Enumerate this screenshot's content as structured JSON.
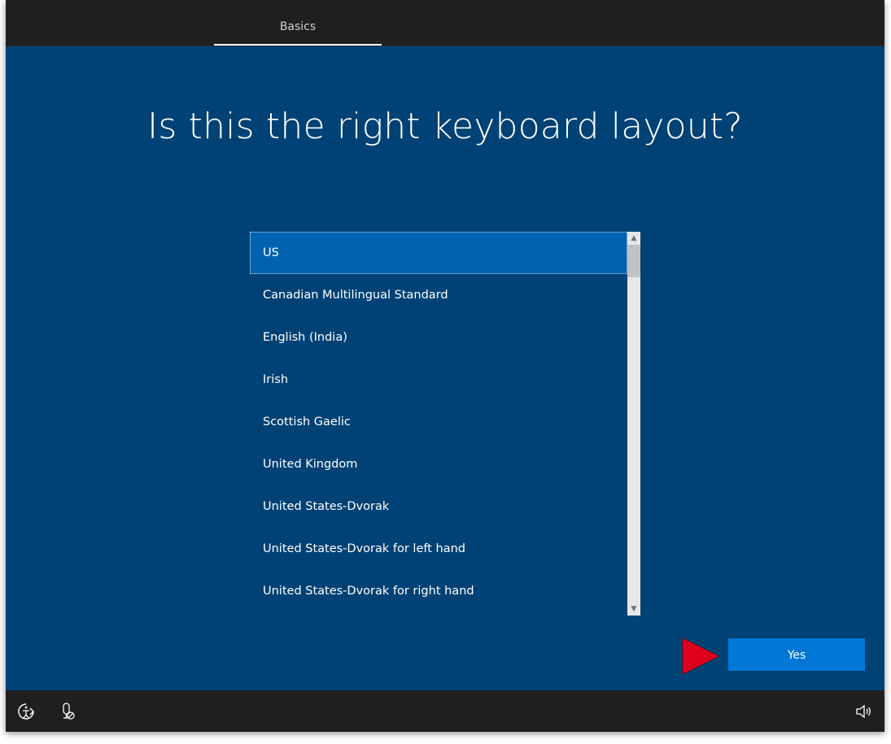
{
  "header": {
    "tabs": [
      {
        "label": "Basics",
        "active": true
      }
    ]
  },
  "main": {
    "title": "Is this the right keyboard layout?",
    "layouts": [
      {
        "label": "US",
        "selected": true
      },
      {
        "label": "Canadian Multilingual Standard"
      },
      {
        "label": "English (India)"
      },
      {
        "label": "Irish"
      },
      {
        "label": "Scottish Gaelic"
      },
      {
        "label": "United Kingdom"
      },
      {
        "label": "United States-Dvorak"
      },
      {
        "label": "United States-Dvorak for left hand"
      },
      {
        "label": "United States-Dvorak for right hand"
      }
    ],
    "yes_button": "Yes"
  },
  "footer": {
    "icons": [
      "ease-of-access-icon",
      "microphone-off-icon",
      "volume-icon"
    ]
  },
  "colors": {
    "background": "#004275",
    "bar": "#1f1f1f",
    "selection": "#0063b1",
    "button": "#0078d7",
    "pointer_arrow": "#e0001b"
  }
}
